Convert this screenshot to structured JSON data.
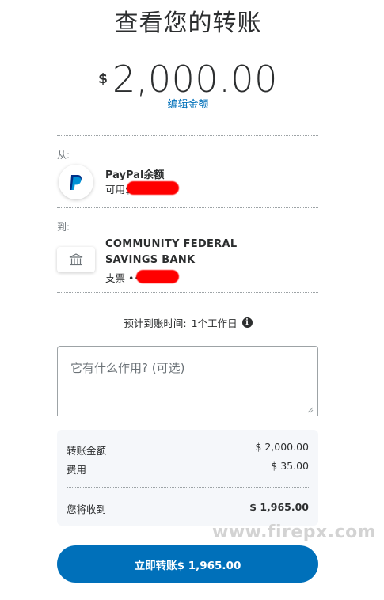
{
  "header": {
    "title": "查看您的转账",
    "currency_symbol": "$",
    "amount": "2,000.00",
    "edit_amount_label": "编辑金额"
  },
  "from": {
    "label": "从:",
    "name": "PayPal余额",
    "sub": "可用$",
    "icon": "paypal-logo"
  },
  "to": {
    "label": "到:",
    "name_line1": "COMMUNITY FEDERAL",
    "name_line2": "SAVINGS BANK",
    "sub": "支票 ••",
    "icon": "bank-icon"
  },
  "eta": {
    "label": "预计到账时间:",
    "value": "1个工作日",
    "icon": "info-icon"
  },
  "note": {
    "placeholder": "它有什么作用? (可选)",
    "value": ""
  },
  "summary": {
    "transfer_label": "转账金额",
    "transfer_value": "$ 2,000.00",
    "fee_label": "费用",
    "fee_value": "$ 35.00",
    "receive_label": "您将收到",
    "receive_value": "$ 1,965.00"
  },
  "action": {
    "label": "立即转账$ 1,965.00"
  },
  "watermark": "www.firepx.com",
  "colors": {
    "brand_blue": "#0070ba",
    "redaction": "#ff0000",
    "summary_bg": "#f5f7fa"
  }
}
